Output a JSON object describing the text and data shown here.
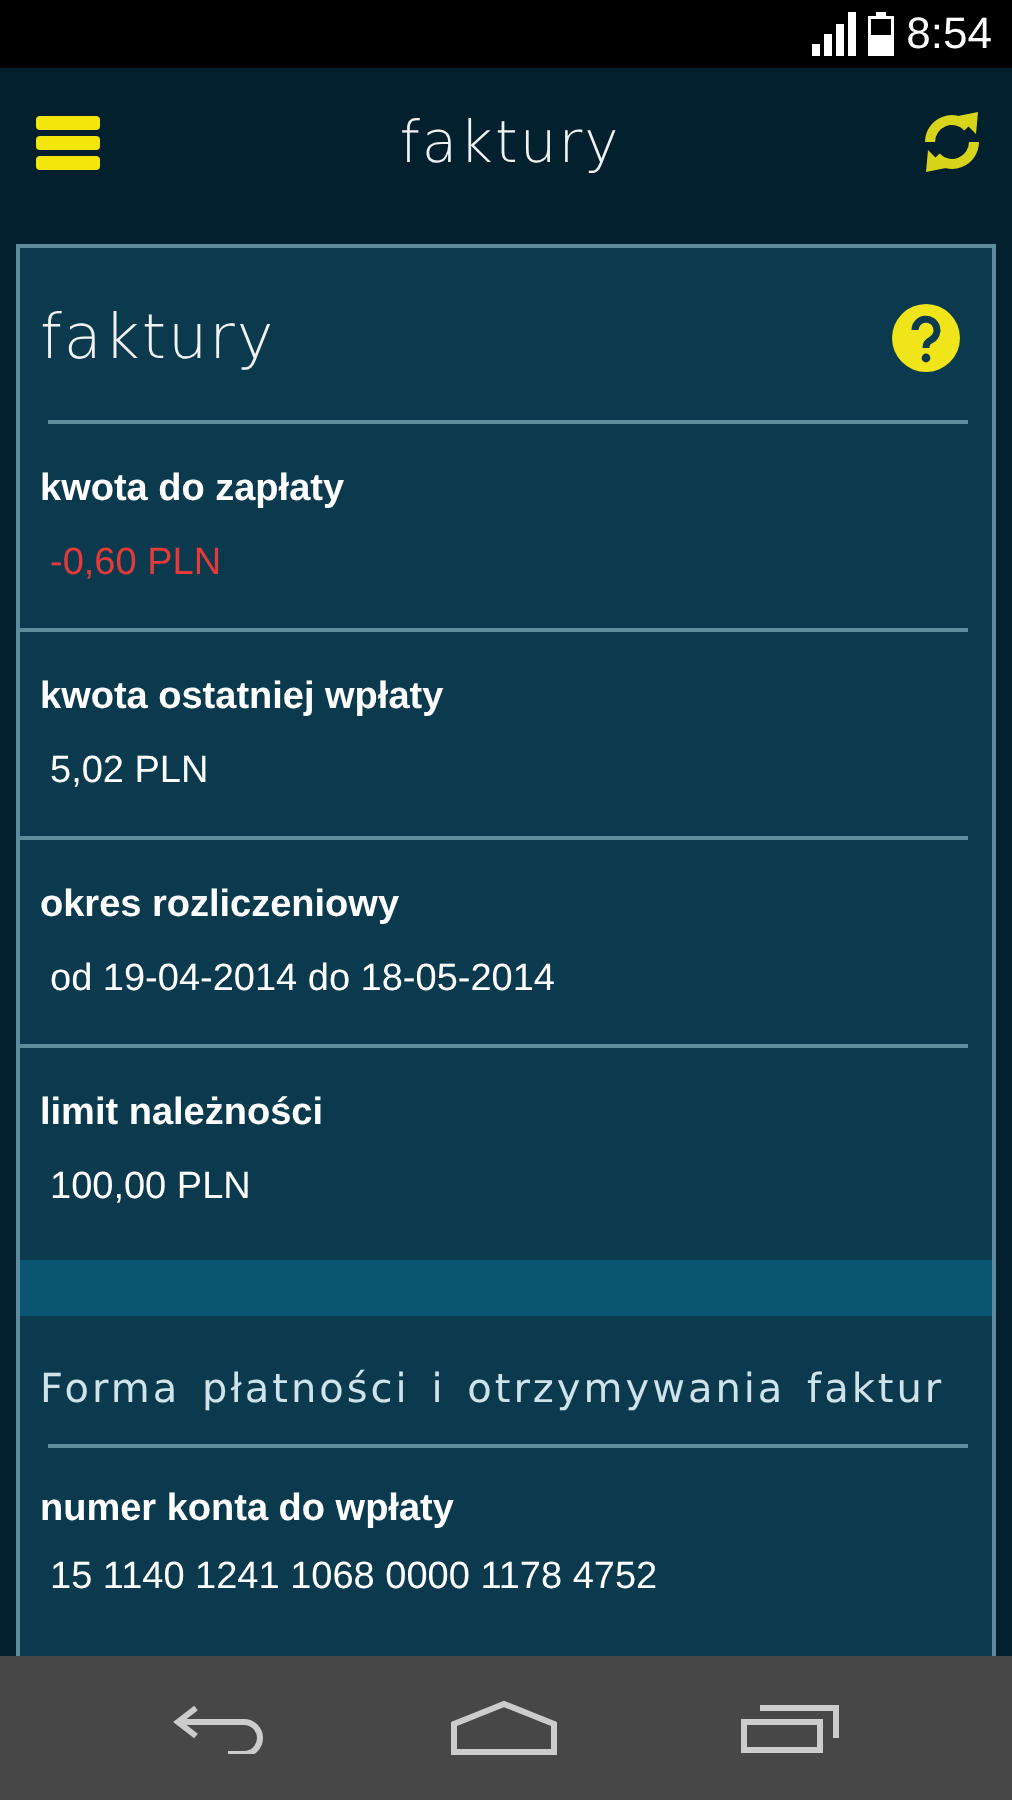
{
  "status_bar": {
    "time": "8:54"
  },
  "app_bar": {
    "title": "faktury"
  },
  "card": {
    "title": "faktury",
    "fields": [
      {
        "label": "kwota do zapłaty",
        "value": "-0,60 PLN",
        "negative": true
      },
      {
        "label": "kwota ostatniej wpłaty",
        "value": "5,02 PLN",
        "negative": false
      },
      {
        "label": "okres rozliczeniowy",
        "value": "od 19-04-2014 do 18-05-2014",
        "negative": false
      },
      {
        "label": "limit należności",
        "value": "100,00 PLN",
        "negative": false
      }
    ],
    "section": {
      "title": "Forma płatności i otrzymywania faktur",
      "fields": [
        {
          "label": "numer konta do wpłaty",
          "value": "15 1140 1241 1068 0000 1178 4752",
          "negative": false
        }
      ]
    }
  }
}
